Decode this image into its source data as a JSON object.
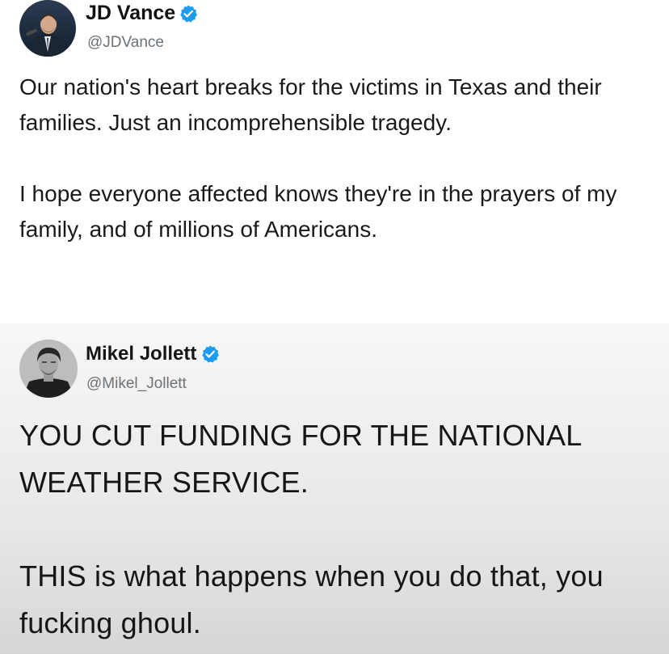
{
  "tweets": [
    {
      "author_name": "JD Vance",
      "handle": "@JDVance",
      "verified": true,
      "avatar": "profile-photo-man-suit-podium",
      "body_paragraphs": [
        "Our nation's heart breaks for the victims in Texas and their families. Just an incomprehensible tragedy.",
        "I hope everyone affected knows they're in the prayers of my family, and of millions of Americans."
      ]
    },
    {
      "author_name": "Mikel Jollett",
      "handle": "@Mikel_Jollett",
      "verified": true,
      "avatar": "profile-photo-man-black-and-white",
      "body_paragraphs": [
        "YOU CUT FUNDING FOR THE NATIONAL WEATHER SERVICE.",
        "THIS is what happens when you do that, you fucking ghoul."
      ]
    }
  ],
  "colors": {
    "verified_badge": "#1d9bf0",
    "handle_text": "#6b7176",
    "body_text": "#1a1a1a"
  },
  "icons": {
    "verified": "verified-badge-icon"
  }
}
